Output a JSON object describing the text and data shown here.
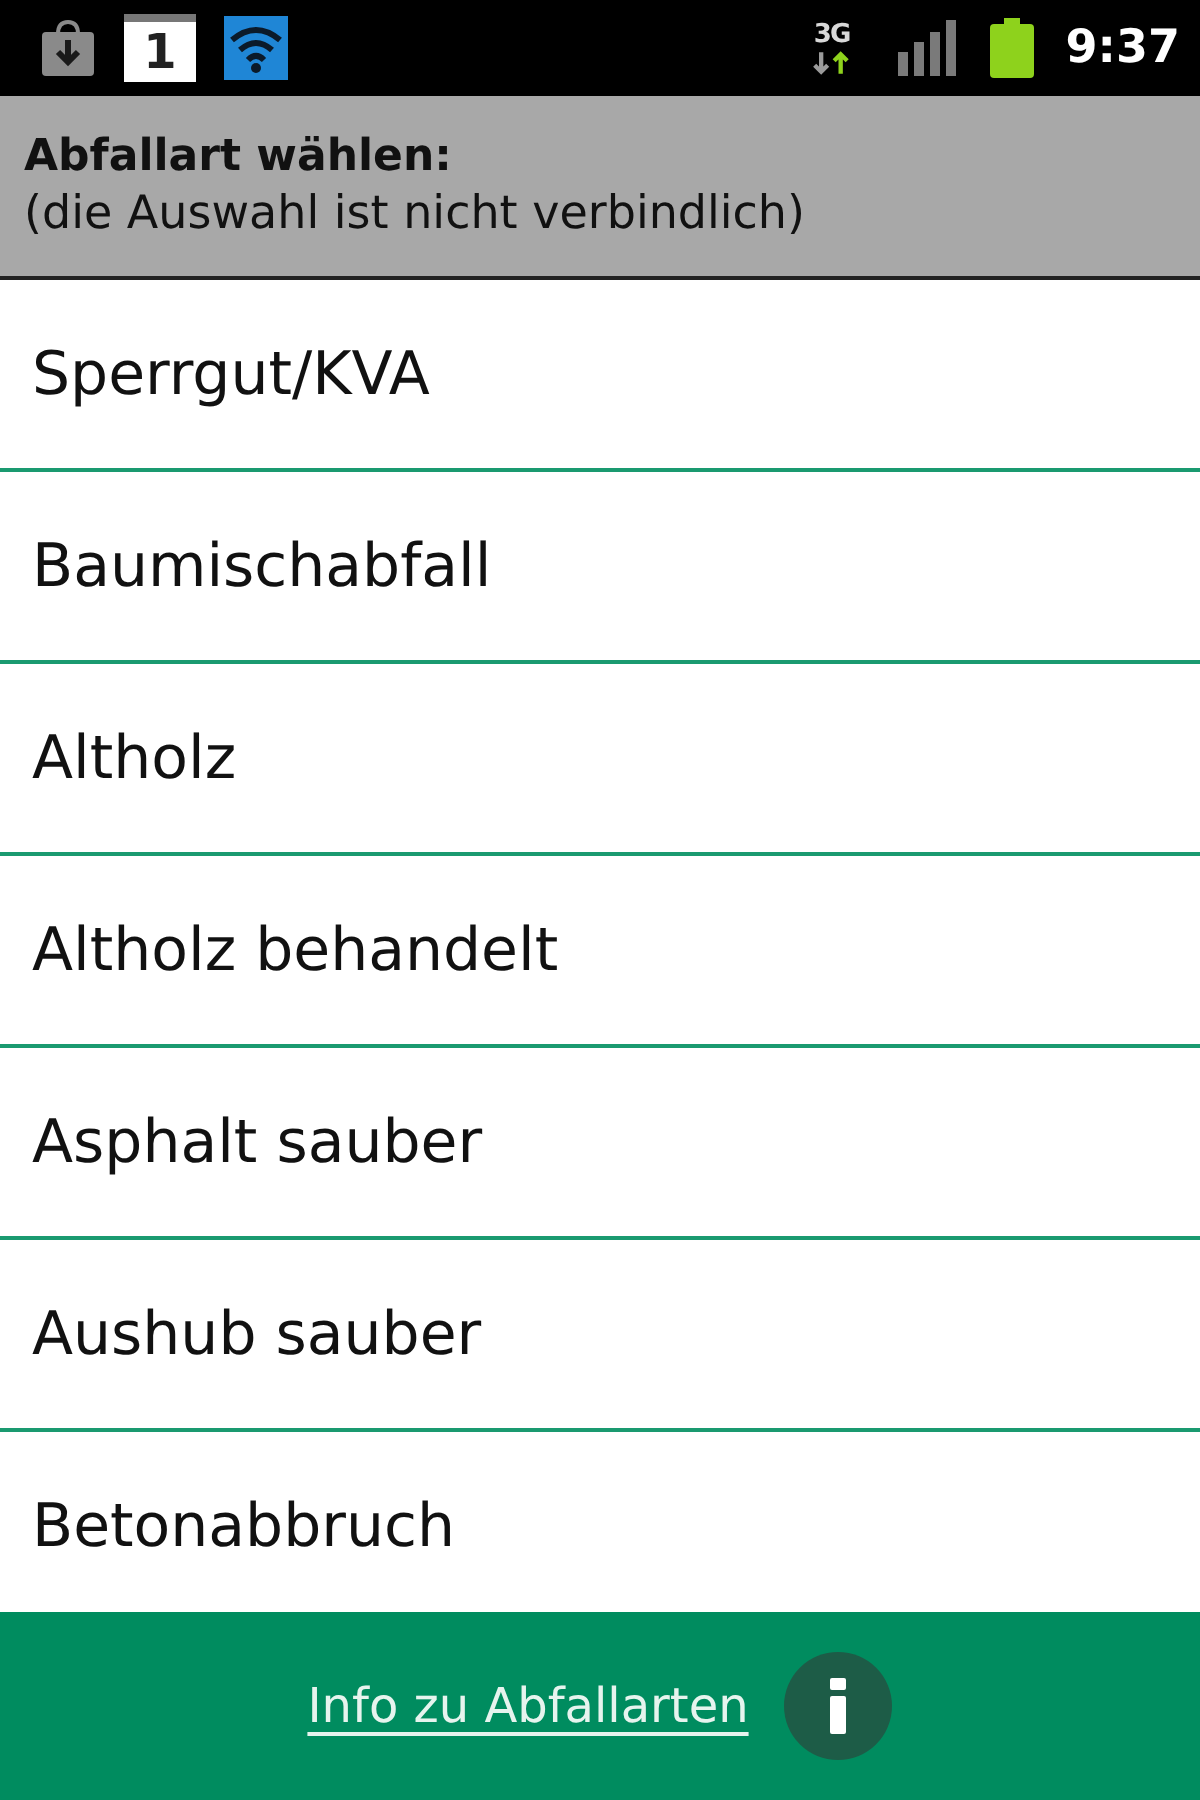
{
  "status_bar": {
    "notifications": [
      {
        "kind": "download"
      },
      {
        "kind": "calendar",
        "text": "1"
      },
      {
        "kind": "wifi"
      }
    ],
    "network": "3G",
    "time": "9:37"
  },
  "header": {
    "title": "Abfallart wählen:",
    "subtitle": "(die Auswahl ist nicht verbindlich)"
  },
  "items": [
    "Sperrgut/KVA",
    "Baumischabfall",
    "Altholz",
    "Altholz behandelt",
    "Asphalt sauber",
    "Aushub sauber",
    "Betonabbruch"
  ],
  "footer": {
    "link": "Info zu Abfallarten"
  }
}
